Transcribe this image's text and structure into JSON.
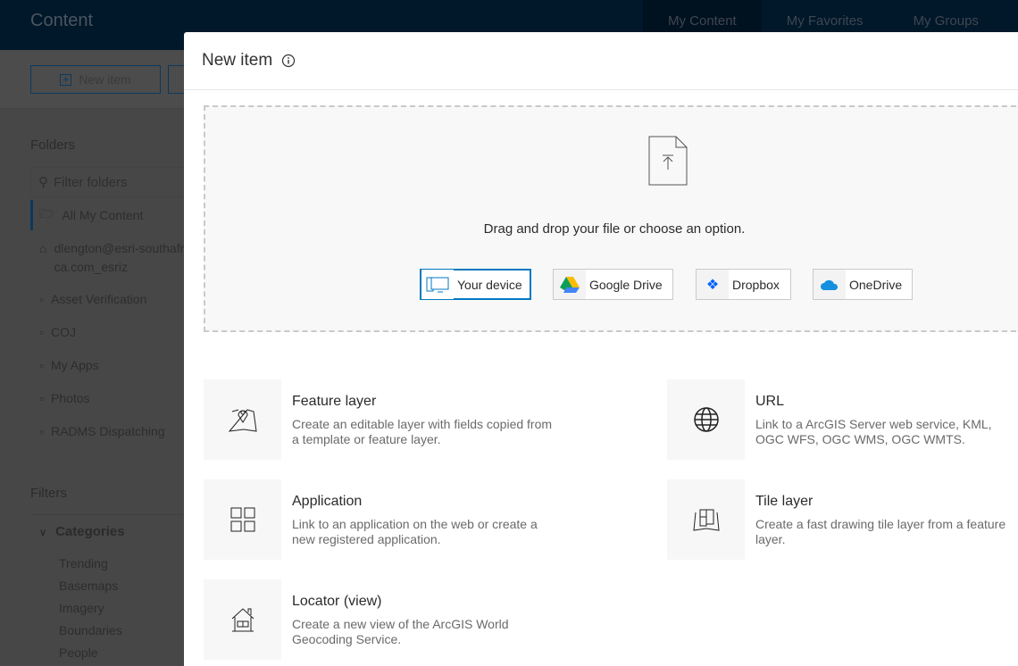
{
  "header": {
    "title": "Content",
    "tabs": [
      "My Content",
      "My Favorites",
      "My Groups"
    ]
  },
  "toolbar": {
    "new_item": "New item"
  },
  "sidebar": {
    "folders_heading": "Folders",
    "filter_placeholder": "Filter folders",
    "folders": [
      "All My Content",
      "dlengton@esri-southafrica.com_esriz",
      "Asset Verification",
      "COJ",
      "My Apps",
      "Photos",
      "RADMS Dispatching"
    ],
    "filters_heading": "Filters",
    "categories_label": "Categories",
    "categories": [
      "Trending",
      "Basemaps",
      "Imagery",
      "Boundaries",
      "People"
    ]
  },
  "modal": {
    "title": "New item",
    "drop_text": "Drag and drop your file or choose an option.",
    "sources": [
      {
        "label": "Your device",
        "icon": "monitor-icon"
      },
      {
        "label": "Google Drive",
        "icon": "google-drive-icon"
      },
      {
        "label": "Dropbox",
        "icon": "dropbox-icon"
      },
      {
        "label": "OneDrive",
        "icon": "onedrive-icon"
      }
    ],
    "items": [
      {
        "title": "Feature layer",
        "desc": "Create an editable layer with fields copied from a template or feature layer.",
        "icon": "map-pin-icon"
      },
      {
        "title": "URL",
        "desc": "Link to a ArcGIS Server web service, KML, OGC WFS, OGC WMS, OGC WMTS.",
        "icon": "globe-icon"
      },
      {
        "title": "Application",
        "desc": "Link to an application on the web or create a new registered application.",
        "icon": "grid-icon"
      },
      {
        "title": "Tile layer",
        "desc": "Create a fast drawing tile layer from a feature layer.",
        "icon": "tile-map-icon"
      },
      {
        "title": "Locator (view)",
        "desc": "Create a new view of the ArcGIS World Geocoding Service.",
        "icon": "house-icon"
      }
    ]
  },
  "colors": {
    "accent": "#0079c1",
    "header": "#00182a"
  }
}
